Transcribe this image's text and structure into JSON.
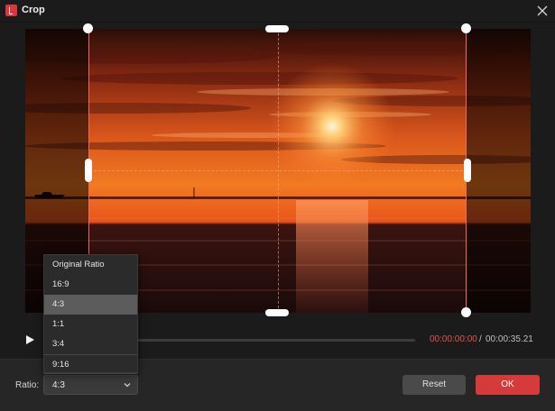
{
  "window": {
    "title": "Crop"
  },
  "icons": {
    "app": "app-logo-icon",
    "close": "close-icon",
    "play": "play-icon",
    "chevron": "chevron-down-icon"
  },
  "colors": {
    "accent": "#d63a3a",
    "time_current": "#e8504a",
    "crop_border": "#f06a5a"
  },
  "player": {
    "time_current": "00:00:00:00",
    "time_separator": "/",
    "time_total": "00:00:35.21"
  },
  "ratio": {
    "label": "Ratio:",
    "selected": "4:3",
    "options": [
      "Original Ratio",
      "16:9",
      "4:3",
      "1:1",
      "3:4",
      "9:16"
    ]
  },
  "buttons": {
    "reset": "Reset",
    "ok": "OK"
  }
}
